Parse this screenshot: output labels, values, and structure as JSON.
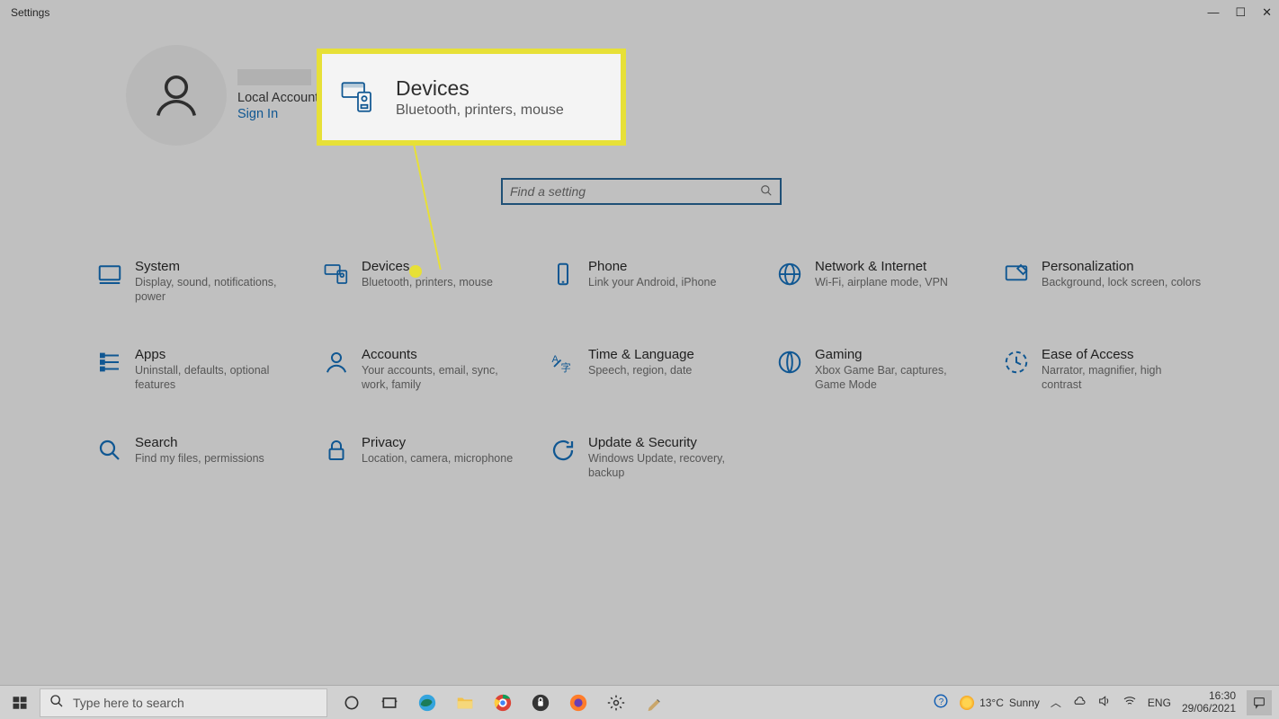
{
  "window": {
    "title": "Settings"
  },
  "user": {
    "account_type": "Local Account",
    "signin": "Sign In"
  },
  "callout": {
    "title": "Devices",
    "subtitle": "Bluetooth, printers, mouse"
  },
  "search": {
    "placeholder": "Find a setting"
  },
  "categories": [
    {
      "id": "system",
      "title": "System",
      "subtitle": "Display, sound, notifications, power"
    },
    {
      "id": "devices",
      "title": "Devices",
      "subtitle": "Bluetooth, printers, mouse"
    },
    {
      "id": "phone",
      "title": "Phone",
      "subtitle": "Link your Android, iPhone"
    },
    {
      "id": "network",
      "title": "Network & Internet",
      "subtitle": "Wi-Fi, airplane mode, VPN"
    },
    {
      "id": "personalization",
      "title": "Personalization",
      "subtitle": "Background, lock screen, colors"
    },
    {
      "id": "apps",
      "title": "Apps",
      "subtitle": "Uninstall, defaults, optional features"
    },
    {
      "id": "accounts",
      "title": "Accounts",
      "subtitle": "Your accounts, email, sync, work, family"
    },
    {
      "id": "time",
      "title": "Time & Language",
      "subtitle": "Speech, region, date"
    },
    {
      "id": "gaming",
      "title": "Gaming",
      "subtitle": "Xbox Game Bar, captures, Game Mode"
    },
    {
      "id": "ease",
      "title": "Ease of Access",
      "subtitle": "Narrator, magnifier, high contrast"
    },
    {
      "id": "search",
      "title": "Search",
      "subtitle": "Find my files, permissions"
    },
    {
      "id": "privacy",
      "title": "Privacy",
      "subtitle": "Location, camera, microphone"
    },
    {
      "id": "update",
      "title": "Update & Security",
      "subtitle": "Windows Update, recovery, backup"
    }
  ],
  "taskbar": {
    "search_placeholder": "Type here to search",
    "weather_temp": "13°C",
    "weather_desc": "Sunny",
    "lang": "ENG",
    "time": "16:30",
    "date": "29/06/2021"
  }
}
